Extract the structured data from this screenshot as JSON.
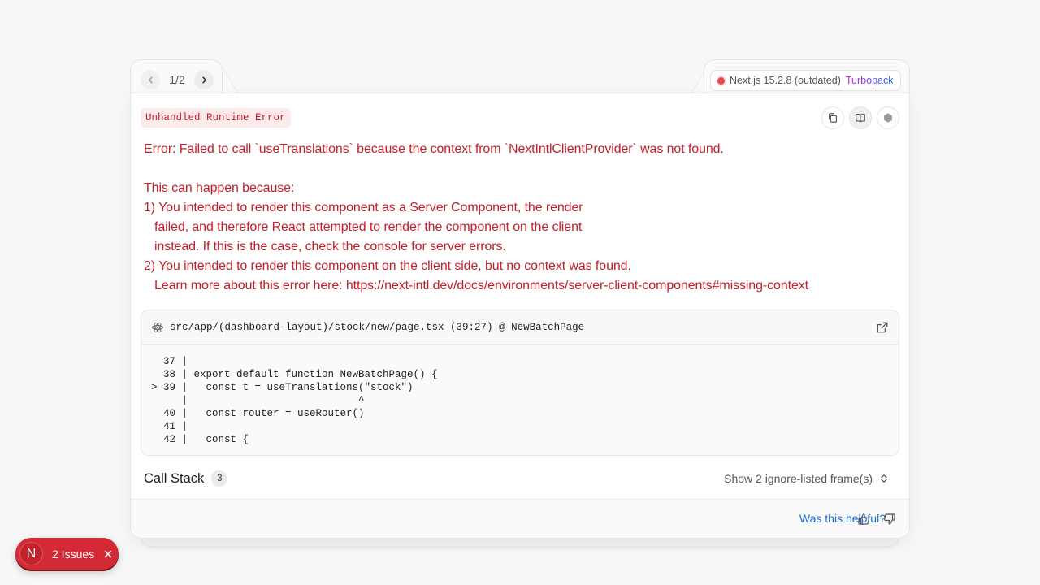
{
  "pager": {
    "text": "1/2"
  },
  "version": {
    "label": "Next.js 15.2.8 (outdated)",
    "bundler": "Turbopack",
    "status_color": "#e5484d"
  },
  "error": {
    "type_label": "Unhandled Runtime Error",
    "message": "Error: Failed to call `useTranslations` because the context from `NextIntlClientProvider` was not found.\n\nThis can happen because:\n1) You intended to render this component as a Server Component, the render\n   failed, and therefore React attempted to render the component on the client\n   instead. If this is the case, check the console for server errors.\n2) You intended to render this component on the client side, but no context was found.\n   Learn more about this error here: https://next-intl.dev/docs/environments/server-client-components#missing-context"
  },
  "codeframe": {
    "path": "src/app/(dashboard-layout)/stock/new/page.tsx (39:27) @ NewBatchPage",
    "code": "  37 |\n  38 | export default function NewBatchPage() {\n> 39 |   const t = useTranslations(\"stock\")\n     |                            ^\n  40 |   const router = useRouter()\n  41 |\n  42 |   const {"
  },
  "callstack": {
    "title": "Call Stack",
    "count": "3",
    "show_frames_label": "Show 2 ignore-listed frame(s)"
  },
  "footer": {
    "helpful_label": "Was this helpful?"
  },
  "issues": {
    "logo_letter": "N",
    "label": "2 Issues"
  },
  "colors": {
    "error_red": "#c4202b",
    "link_blue": "#1a6ed8",
    "pill_red": "#d42a35"
  }
}
